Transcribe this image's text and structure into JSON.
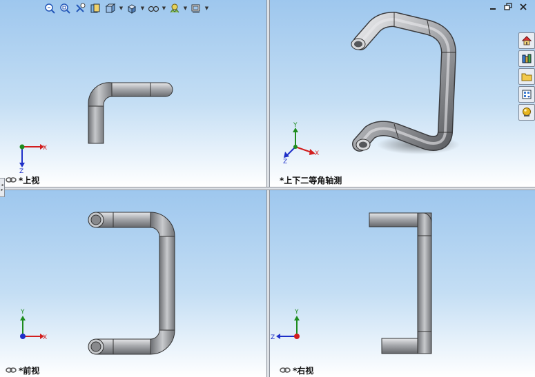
{
  "views": {
    "top": {
      "label": "*上视"
    },
    "iso": {
      "label": "*上下二等角轴测"
    },
    "front": {
      "label": "*前视"
    },
    "right": {
      "label": "*右视"
    }
  },
  "axes": {
    "x": "X",
    "y": "Y",
    "z": "Z"
  },
  "toolbar": {
    "icons": [
      "zoom-to-fit-icon",
      "zoom-area-icon",
      "previous-view-icon",
      "section-view-icon",
      "view-orientation-icon",
      "display-style-icon",
      "hide-show-items-icon",
      "edit-appearance-icon",
      "apply-scene-icon"
    ]
  },
  "taskpane": {
    "icons": [
      "solidworks-resources-icon",
      "design-library-icon",
      "file-explorer-icon",
      "view-palette-icon",
      "appearances-scenes-icon"
    ]
  },
  "colors": {
    "pipe": "#a4a6aa",
    "viewport_top": "#9ec7ee",
    "viewport_bottom": "#ffffff",
    "axis_x": "#d21e1e",
    "axis_y": "#1e8c1e",
    "axis_z": "#1e2fc8"
  }
}
